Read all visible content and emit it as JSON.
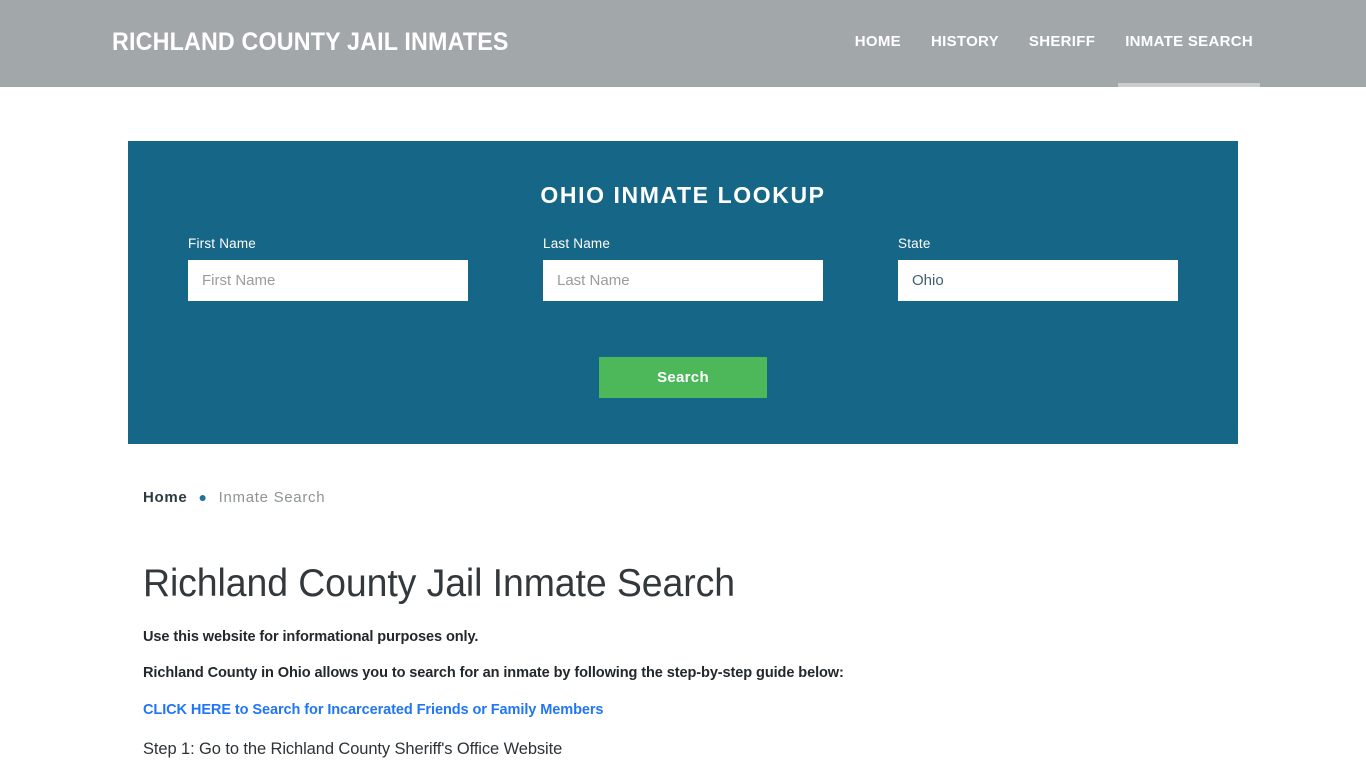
{
  "header": {
    "site_title": "RICHLAND COUNTY JAIL INMATES",
    "background_color": "#a2a7aa",
    "nav": [
      {
        "label": "HOME",
        "active": false
      },
      {
        "label": "HISTORY",
        "active": false
      },
      {
        "label": "SHERIFF",
        "active": false
      },
      {
        "label": "INMATE SEARCH",
        "active": true
      }
    ]
  },
  "lookup_panel": {
    "title": "OHIO INMATE LOOKUP",
    "background_color": "#166687",
    "fields": [
      {
        "label": "First Name",
        "placeholder": "First Name",
        "value": ""
      },
      {
        "label": "Last Name",
        "placeholder": "Last Name",
        "value": ""
      },
      {
        "label": "State",
        "value": "Ohio"
      }
    ],
    "submit_label": "Search",
    "submit_color": "#4cb85a"
  },
  "breadcrumb": {
    "home_label": "Home",
    "separator": "●",
    "current_label": "Inmate Search"
  },
  "main": {
    "page_title": "Richland County Jail Inmate Search",
    "paragraph_1": "Use this website for informational purposes only.",
    "paragraph_2": "Richland County in Ohio allows you to search for an inmate by following the step-by-step guide below:",
    "link_text": "CLICK HERE to Search for Incarcerated Friends or Family Members",
    "link_color": "#2176f5",
    "step_1": "Step 1: Go to the Richland County Sheriff's Office Website"
  }
}
